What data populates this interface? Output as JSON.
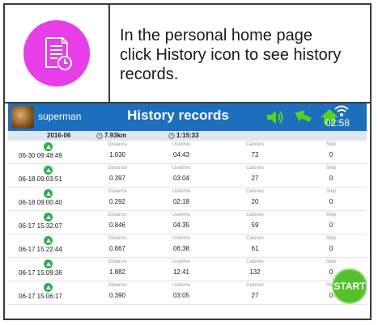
{
  "instruction": {
    "line1": "In the personal home page",
    "line2": "click History icon to see history",
    "line3": "records."
  },
  "app": {
    "username": "superman",
    "title": "History records",
    "time": "02:58",
    "start_label": "START"
  },
  "colors": {
    "accent": "#1d6fbd",
    "icon_bg": "#e83ee8",
    "topbar_icons": "#5bd11f",
    "run_badge": "#2fae4a",
    "start_button": "#55c02c"
  },
  "summary": {
    "month": "2016-06",
    "distance": "7.93km",
    "duration": "1:15:33"
  },
  "columns": {
    "distance": "Distance",
    "usetime": "Usetime",
    "calories": "Calories",
    "step": "Step"
  },
  "records": [
    {
      "datetime": "06-30 09:48:49",
      "distance": "1.030",
      "usetime": "04:43",
      "calories": "72",
      "step": "0"
    },
    {
      "datetime": "06-18 09:03:51",
      "distance": "0.397",
      "usetime": "03:04",
      "calories": "27",
      "step": "0"
    },
    {
      "datetime": "06-18 09:00:40",
      "distance": "0.292",
      "usetime": "02:18",
      "calories": "20",
      "step": "0"
    },
    {
      "datetime": "06-17 15:32:07",
      "distance": "0.846",
      "usetime": "04:35",
      "calories": "59",
      "step": "0"
    },
    {
      "datetime": "06-17 15:22:44",
      "distance": "0.867",
      "usetime": "06:38",
      "calories": "61",
      "step": "0"
    },
    {
      "datetime": "06-17 15:09:36",
      "distance": "1.882",
      "usetime": "12:41",
      "calories": "132",
      "step": "0"
    },
    {
      "datetime": "06-17 15:06:17",
      "distance": "0.390",
      "usetime": "03:05",
      "calories": "27",
      "step": "0"
    }
  ],
  "icons": [
    "history-document-clock-icon",
    "volume-icon",
    "back-arrow-icon",
    "home-icon",
    "wifi-icon",
    "running-icon",
    "clock-icon"
  ]
}
